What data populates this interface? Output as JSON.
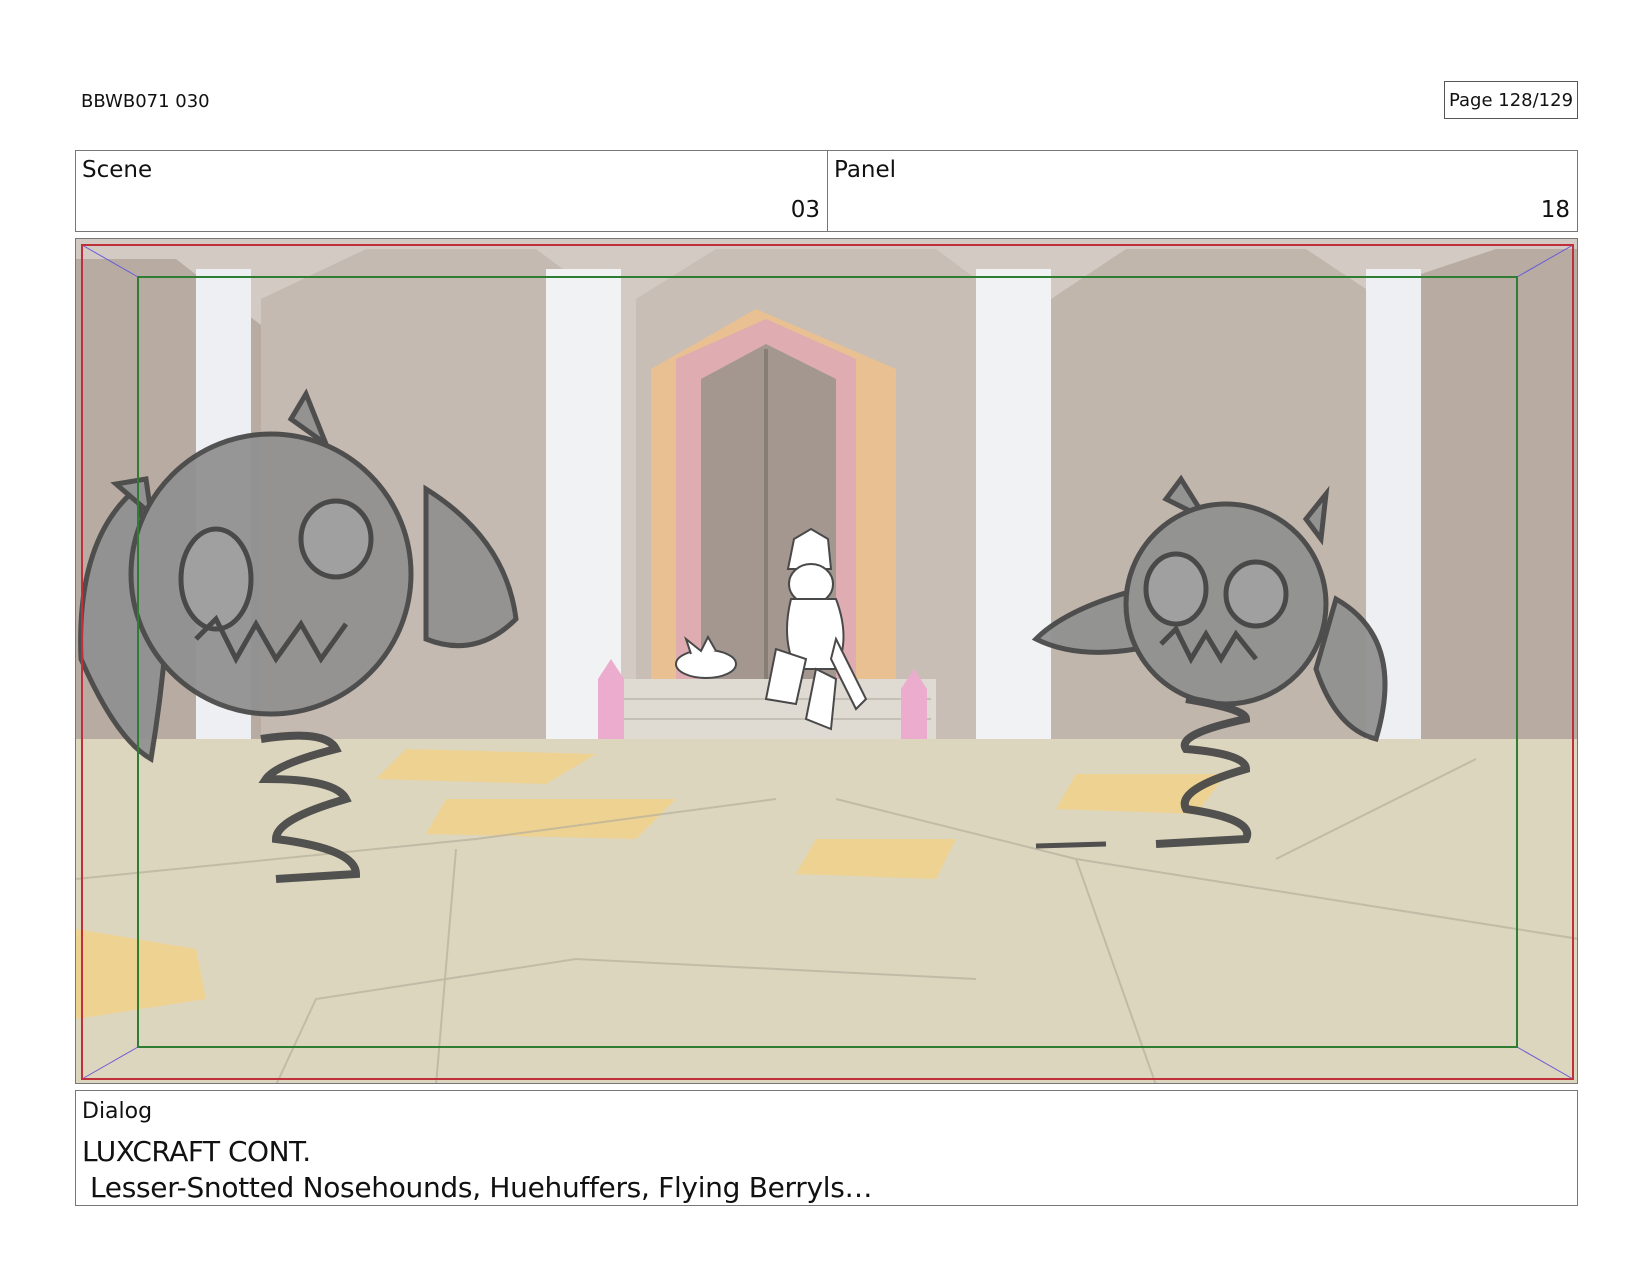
{
  "header": {
    "production_id": "BBWB071 030",
    "page": "Page 128/129"
  },
  "scene_panel": {
    "scene_label": "Scene",
    "scene_value": "03",
    "panel_label": "Panel",
    "panel_value": "18"
  },
  "dialog": {
    "label": "Dialog",
    "speaker": "LUXCRAFT CONT.",
    "line": "Lesser-Snotted Nosehounds, Huehuffers, Flying Berryls…"
  },
  "colors": {
    "action_safe": "#c0303a",
    "title_safe": "#2e7d32",
    "floor": "#d9d0b4",
    "creature_fill": "#7a7a7a"
  }
}
